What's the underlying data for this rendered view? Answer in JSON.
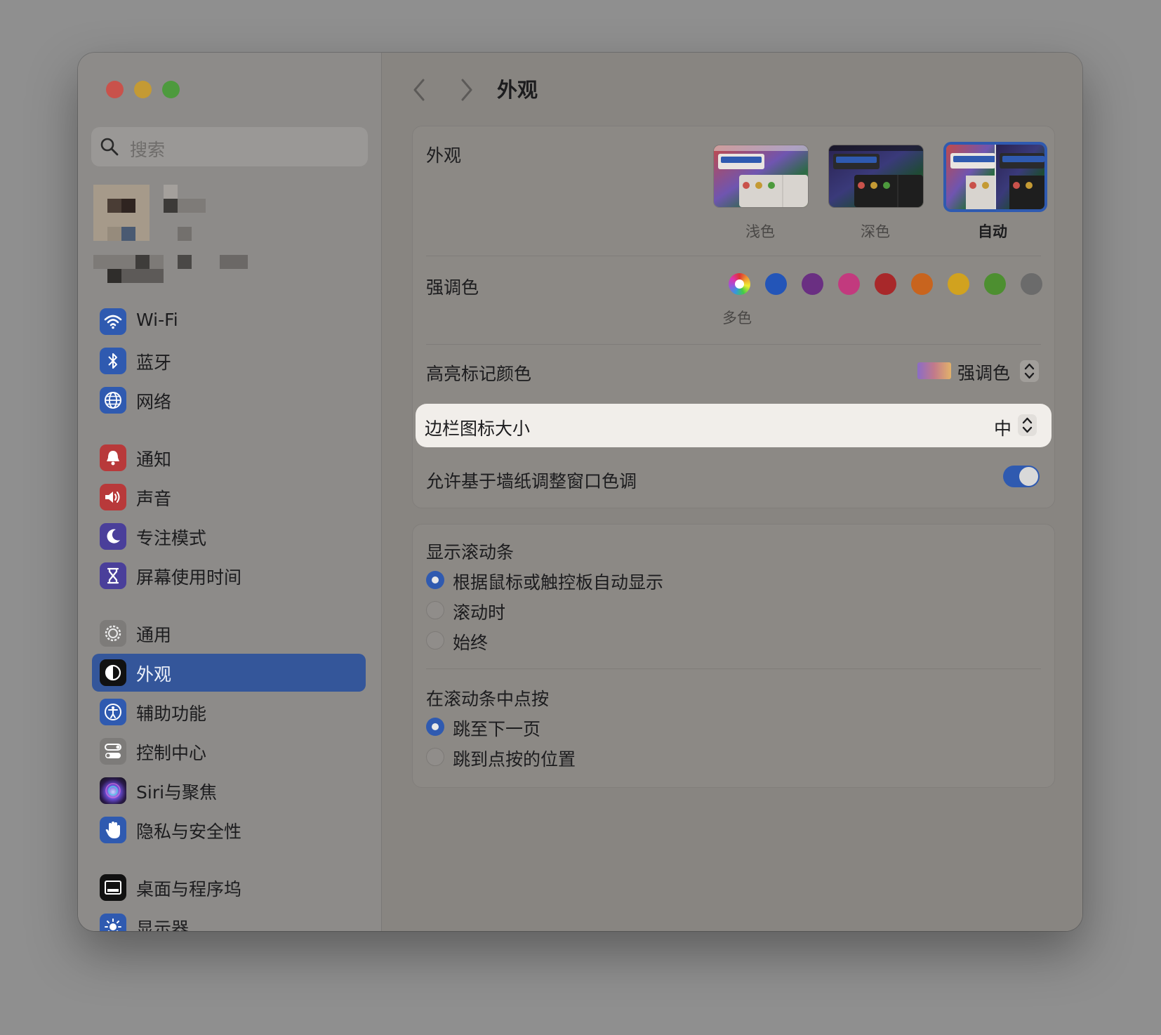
{
  "window": {
    "title": "外观"
  },
  "search": {
    "placeholder": "搜索"
  },
  "sidebar": {
    "items": [
      {
        "label": "Wi-Fi",
        "icon": "wifi-icon"
      },
      {
        "label": "蓝牙",
        "icon": "bluetooth-icon"
      },
      {
        "label": "网络",
        "icon": "globe-icon"
      },
      {
        "label": "通知",
        "icon": "bell-icon"
      },
      {
        "label": "声音",
        "icon": "speaker-icon"
      },
      {
        "label": "专注模式",
        "icon": "moon-icon"
      },
      {
        "label": "屏幕使用时间",
        "icon": "hourglass-icon"
      },
      {
        "label": "通用",
        "icon": "gear-icon"
      },
      {
        "label": "外观",
        "icon": "appearance-icon",
        "selected": true
      },
      {
        "label": "辅助功能",
        "icon": "accessibility-icon"
      },
      {
        "label": "控制中心",
        "icon": "toggles-icon"
      },
      {
        "label": "Siri与聚焦",
        "icon": "siri-icon"
      },
      {
        "label": "隐私与安全性",
        "icon": "hand-icon"
      },
      {
        "label": "桌面与程序坞",
        "icon": "dock-icon"
      },
      {
        "label": "显示器",
        "icon": "sun-icon"
      }
    ]
  },
  "appearance": {
    "label": "外观",
    "options": [
      {
        "label": "浅色",
        "selected": false
      },
      {
        "label": "深色",
        "selected": false
      },
      {
        "label": "自动",
        "selected": true
      }
    ]
  },
  "accent": {
    "label": "强调色",
    "selected_caption": "多色",
    "colors": [
      "multicolor",
      "#2355b8",
      "#6a2f82",
      "#c23a7e",
      "#a8282a",
      "#c8641e",
      "#d1a21f",
      "#4d8f30",
      "#6b6b6b"
    ]
  },
  "highlight_color": {
    "label": "高亮标记颜色",
    "value": "强调色"
  },
  "sidebar_icon_size": {
    "label": "边栏图标大小",
    "value": "中"
  },
  "wallpaper_tinting": {
    "label": "允许基于墙纸调整窗口色调",
    "enabled": true
  },
  "show_scrollbars": {
    "label": "显示滚动条",
    "options": [
      {
        "label": "根据鼠标或触控板自动显示",
        "selected": true
      },
      {
        "label": "滚动时",
        "selected": false
      },
      {
        "label": "始终",
        "selected": false
      }
    ]
  },
  "click_scrollbar": {
    "label": "在滚动条中点按",
    "options": [
      {
        "label": "跳至下一页",
        "selected": true
      },
      {
        "label": "跳到点按的位置",
        "selected": false
      }
    ]
  },
  "help": {
    "label": "?"
  },
  "colors": {
    "accent": "#2f5ab0",
    "selected_sidebar": "#34569a"
  }
}
